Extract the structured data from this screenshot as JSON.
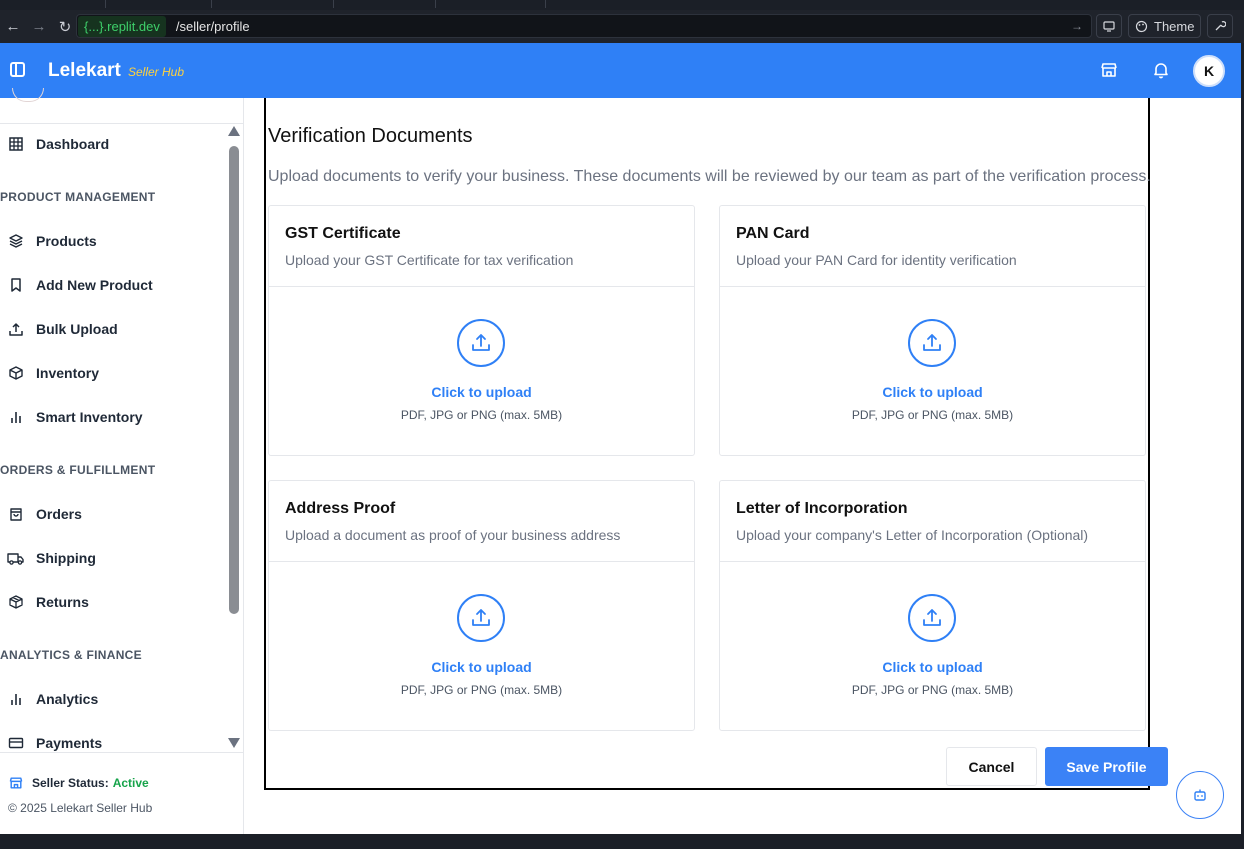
{
  "browser": {
    "host": "{...}.replit.dev",
    "path": "/seller/profile",
    "theme_label": "Theme"
  },
  "header": {
    "brand": "Lelekart",
    "brand_sub": "Seller Hub",
    "avatar_initial": "K"
  },
  "sidebar": {
    "items": [
      {
        "label": "Dashboard"
      },
      {
        "label": "Products"
      },
      {
        "label": "Add New Product"
      },
      {
        "label": "Bulk Upload"
      },
      {
        "label": "Inventory"
      },
      {
        "label": "Smart Inventory"
      },
      {
        "label": "Orders"
      },
      {
        "label": "Shipping"
      },
      {
        "label": "Returns"
      },
      {
        "label": "Analytics"
      },
      {
        "label": "Payments"
      }
    ],
    "sections": {
      "product_management": "PRODUCT MANAGEMENT",
      "orders_fulfillment": "ORDERS & FULFILLMENT",
      "analytics_finance": "ANALYTICS & FINANCE"
    },
    "status_label": "Seller Status:",
    "status_value": "Active",
    "copyright": "© 2025 Lelekart Seller Hub"
  },
  "main": {
    "title": "Verification Documents",
    "description": "Upload documents to verify your business. These documents will be reviewed by our team as part of the verification process.",
    "cards": [
      {
        "title": "GST Certificate",
        "subtitle": "Upload your GST Certificate for tax verification",
        "link": "Click to upload",
        "hint": "PDF, JPG or PNG (max. 5MB)"
      },
      {
        "title": "PAN Card",
        "subtitle": "Upload your PAN Card for identity verification",
        "link": "Click to upload",
        "hint": "PDF, JPG or PNG (max. 5MB)"
      },
      {
        "title": "Address Proof",
        "subtitle": "Upload a document as proof of your business address",
        "link": "Click to upload",
        "hint": "PDF, JPG or PNG (max. 5MB)"
      },
      {
        "title": "Letter of Incorporation",
        "subtitle": "Upload your company's Letter of Incorporation (Optional)",
        "link": "Click to upload",
        "hint": "PDF, JPG or PNG (max. 5MB)"
      }
    ],
    "cancel_label": "Cancel",
    "save_label": "Save Profile"
  },
  "colors": {
    "primary": "#2f80f6",
    "active": "#16a34a",
    "brand_sub": "#ffd23f"
  }
}
